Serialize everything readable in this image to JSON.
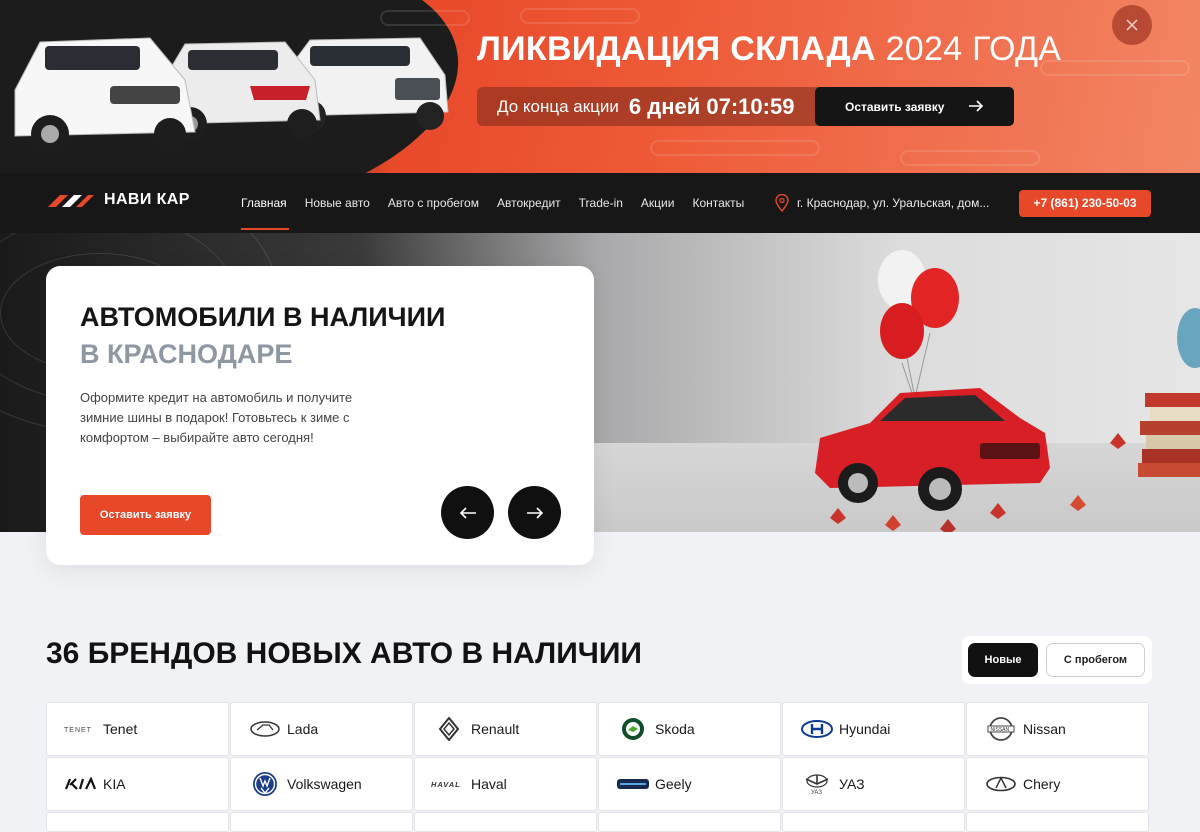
{
  "promo": {
    "title_bold": "ЛИКВИДАЦИЯ СКЛАДА",
    "title_rest": "2024 ГОДА",
    "countdown_label": "До конца акции",
    "countdown_value": "6 дней 07:10:59",
    "button_label": "Оставить заявку",
    "accent": "#e7482a"
  },
  "nav": {
    "brand": "НАВИ КАР",
    "menu": [
      "Главная",
      "Новые авто",
      "Авто с пробегом",
      "Автокредит",
      "Trade-in",
      "Акции",
      "Контакты"
    ],
    "address": "г. Краснодар, ул. Уральская, дом...",
    "phone": "+7 (861) 230-50-03"
  },
  "hero": {
    "title": "АВТОМОБИЛИ В НАЛИЧИИ",
    "subtitle": "В КРАСНОДАРЕ",
    "text": "Оформите кредит на автомобиль и получите зимние шины в подарок! Готовьтесь к зиме с комфортом – выбирайте авто сегодня!",
    "button_label": "Оставить заявку"
  },
  "brands": {
    "title": "36 БРЕНДОВ НОВЫХ АВТО В НАЛИЧИИ",
    "toggle": [
      "Новые",
      "С пробегом"
    ],
    "items": [
      {
        "name": "Tenet",
        "icon": "tenet-logo"
      },
      {
        "name": "Lada",
        "icon": "lada-logo"
      },
      {
        "name": "Renault",
        "icon": "renault-logo"
      },
      {
        "name": "Skoda",
        "icon": "skoda-logo"
      },
      {
        "name": "Hyundai",
        "icon": "hyundai-logo"
      },
      {
        "name": "Nissan",
        "icon": "nissan-logo"
      },
      {
        "name": "KIA",
        "icon": "kia-logo"
      },
      {
        "name": "Volkswagen",
        "icon": "volkswagen-logo"
      },
      {
        "name": "Haval",
        "icon": "haval-logo"
      },
      {
        "name": "Geely",
        "icon": "geely-logo"
      },
      {
        "name": "УАЗ",
        "icon": "uaz-logo"
      },
      {
        "name": "Chery",
        "icon": "chery-logo"
      }
    ]
  }
}
